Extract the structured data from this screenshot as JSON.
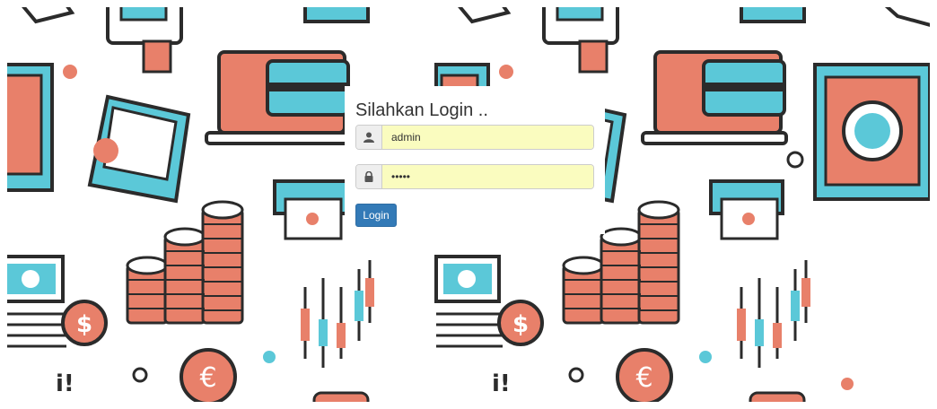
{
  "login": {
    "title": "Silahkan Login ..",
    "username_value": "admin",
    "password_value": "•••••",
    "username_icon": "user-icon",
    "password_icon": "lock-icon",
    "button_label": "Login"
  },
  "background": {
    "theme": "finance-illustration-pattern",
    "colors": {
      "outline": "#2b2b2b",
      "coral": "#e8806a",
      "teal": "#5bc8d8",
      "white": "#ffffff"
    }
  },
  "colors": {
    "button": "#337ab7",
    "autofill": "#fafcbf",
    "addon": "#eeeeee"
  }
}
